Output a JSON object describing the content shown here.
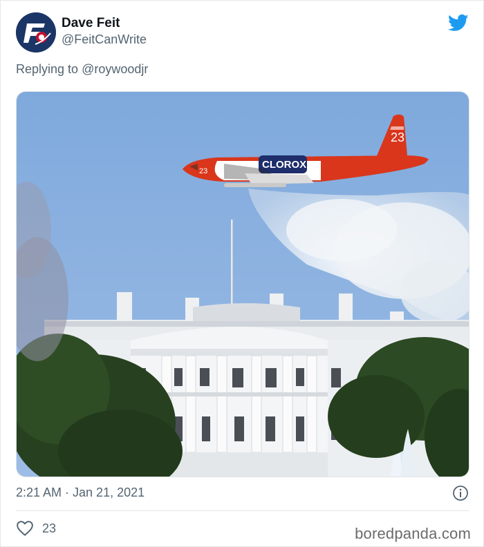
{
  "tweet": {
    "author_name": "Dave Feit",
    "author_handle": "@FeitCanWrite",
    "replying_prefix": "Replying to",
    "replying_handle": "@roywoodjr",
    "timestamp": "2:21 AM · Jan 21, 2021",
    "like_count": "23"
  },
  "media": {
    "plane_number": "23",
    "plane_text": "CLOROX"
  },
  "icons": {
    "avatar": "avatar-logo",
    "platform": "twitter-bird-icon",
    "info": "info-icon",
    "like": "heart-icon"
  },
  "colors": {
    "twitter_blue": "#1d9bf0",
    "muted_text": "#536471",
    "plane_red": "#d9361c"
  },
  "footer": {
    "watermark": "boredpanda.com"
  }
}
